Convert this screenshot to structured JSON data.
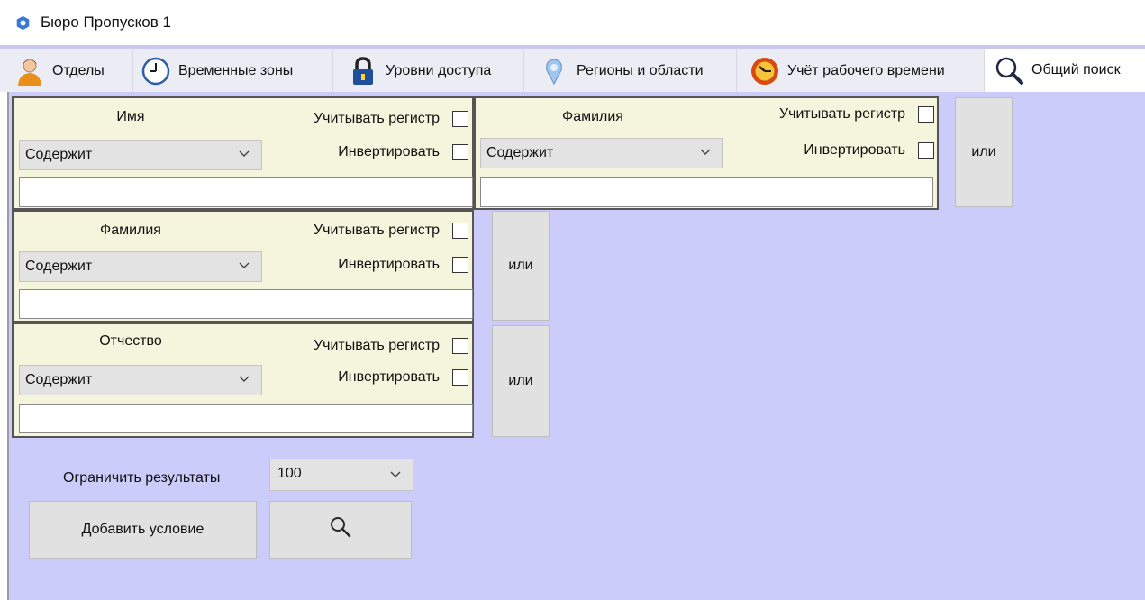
{
  "window": {
    "title": "Бюро Пропусков 1"
  },
  "tabs": [
    {
      "label": "Отделы",
      "icon": "person-icon"
    },
    {
      "label": "Временные зоны",
      "icon": "clock-icon"
    },
    {
      "label": "Уровни доступа",
      "icon": "padlock-icon"
    },
    {
      "label": "Регионы и области",
      "icon": "map-pin-icon"
    },
    {
      "label": "Учёт рабочего времени",
      "icon": "time-tracking-icon"
    },
    {
      "label": "Общий поиск",
      "icon": "magnifier-icon",
      "active": true
    }
  ],
  "conditions": [
    {
      "field": "Имя",
      "case_label": "Учитывать регистр",
      "invert_label": "Инвертировать",
      "mode": "Содержит",
      "value": "",
      "case_checked": false,
      "invert_checked": false
    },
    {
      "field": "Фамилия",
      "case_label": "Учитывать регистр",
      "invert_label": "Инвертировать",
      "mode": "Содержит",
      "value": "",
      "case_checked": false,
      "invert_checked": false
    },
    {
      "field": "Фамилия",
      "case_label": "Учитывать регистр",
      "invert_label": "Инвертировать",
      "mode": "Содержит",
      "value": "",
      "case_checked": false,
      "invert_checked": false
    },
    {
      "field": "Отчество",
      "case_label": "Учитывать регистр",
      "invert_label": "Инвертировать",
      "mode": "Содержит",
      "value": "",
      "case_checked": false,
      "invert_checked": false
    }
  ],
  "or_label": "или",
  "limit": {
    "label": "Ограничить результаты",
    "value": "100"
  },
  "add_condition_label": "Добавить условие",
  "colors": {
    "content_bg": "#ccccfa",
    "condition_bg": "#f5f4dc",
    "button_bg": "#e1e1e1"
  }
}
